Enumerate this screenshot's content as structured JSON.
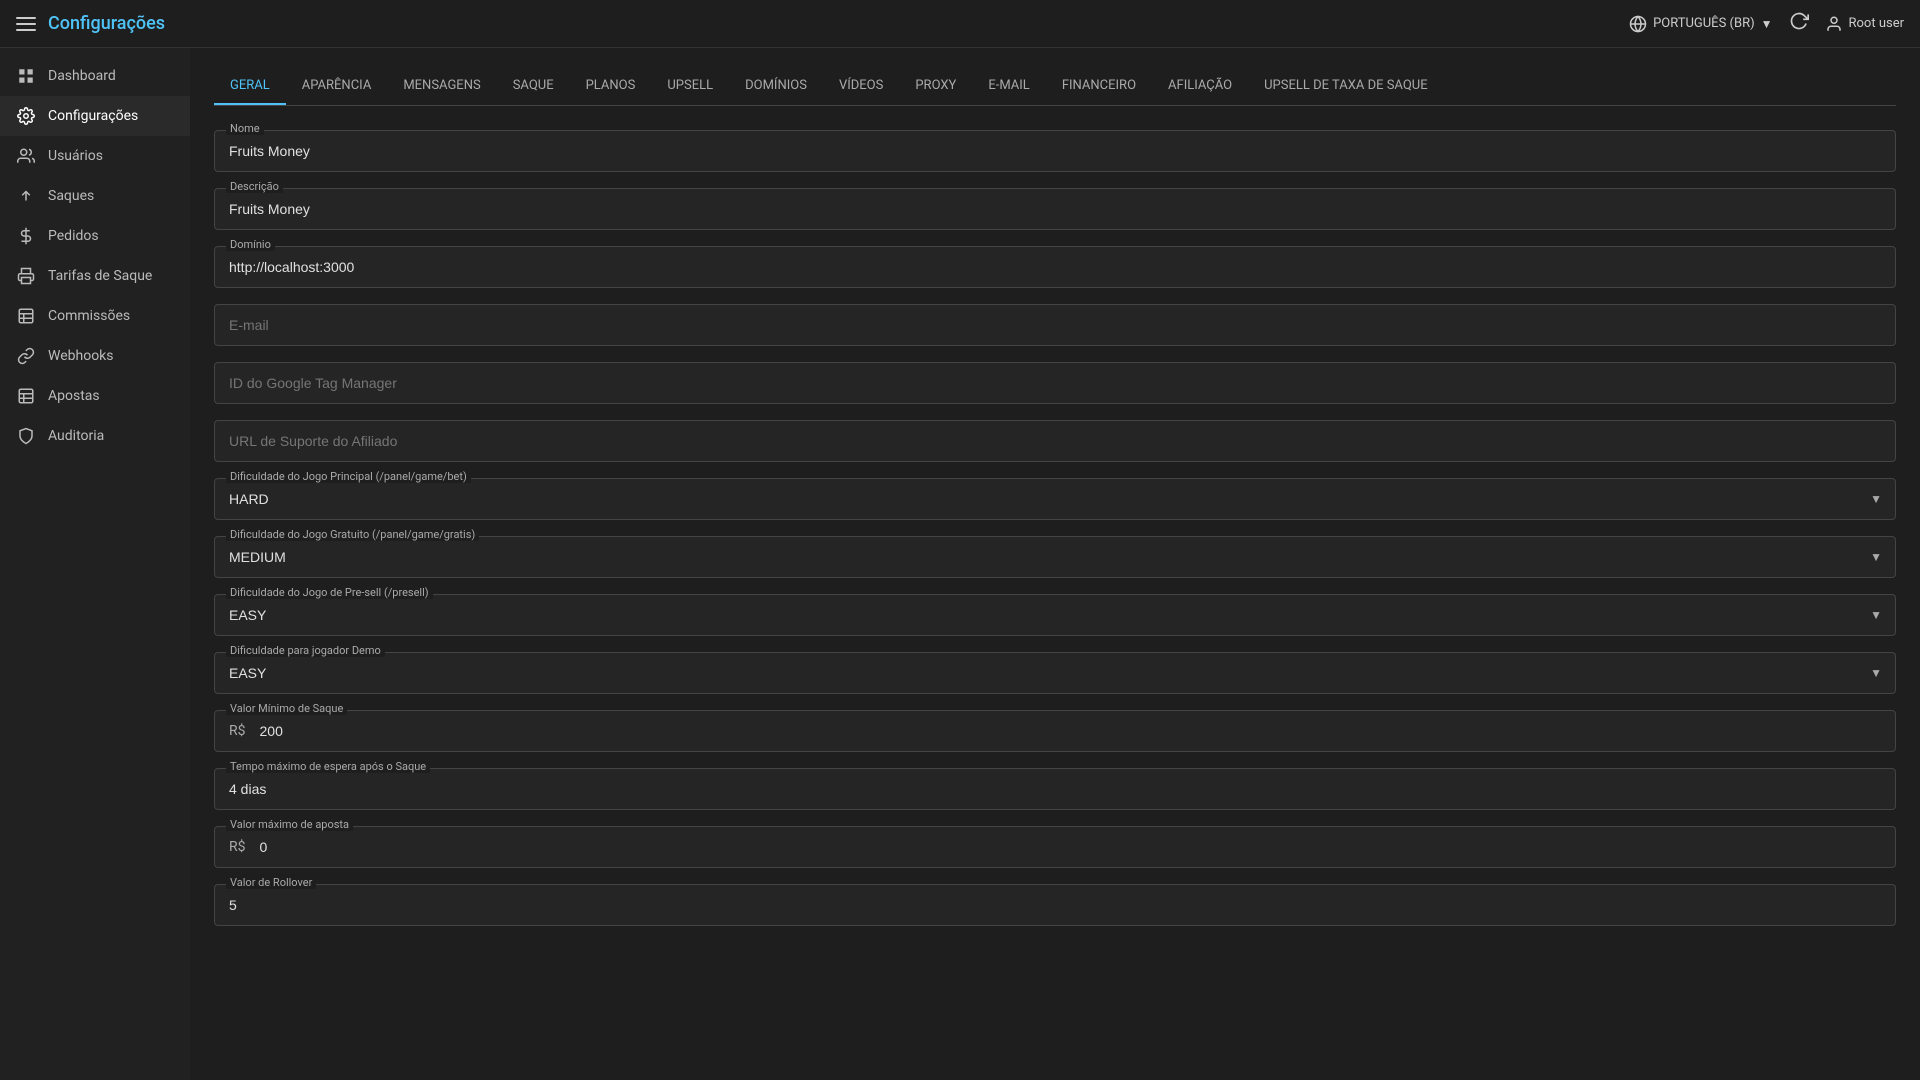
{
  "topbar": {
    "title": "Configurações",
    "language": "PORTUGUÊS (BR)",
    "user": "Root user"
  },
  "sidebar": {
    "items": [
      {
        "id": "dashboard",
        "label": "Dashboard",
        "icon": "grid"
      },
      {
        "id": "configuracoes",
        "label": "Configurações",
        "icon": "settings",
        "active": true
      },
      {
        "id": "usuarios",
        "label": "Usuários",
        "icon": "people"
      },
      {
        "id": "saques",
        "label": "Saques",
        "icon": "upload"
      },
      {
        "id": "pedidos",
        "label": "Pedidos",
        "icon": "dollar"
      },
      {
        "id": "tarifas",
        "label": "Tarifas de Saque",
        "icon": "receipt"
      },
      {
        "id": "comissoes",
        "label": "Commissões",
        "icon": "table"
      },
      {
        "id": "webhooks",
        "label": "Webhooks",
        "icon": "link"
      },
      {
        "id": "apostas",
        "label": "Apostas",
        "icon": "table2"
      },
      {
        "id": "auditoria",
        "label": "Auditoria",
        "icon": "shield"
      }
    ]
  },
  "tabs": [
    {
      "id": "geral",
      "label": "GERAL",
      "active": true
    },
    {
      "id": "aparencia",
      "label": "APARÊNCIA"
    },
    {
      "id": "mensagens",
      "label": "MENSAGENS"
    },
    {
      "id": "saque",
      "label": "SAQUE"
    },
    {
      "id": "planos",
      "label": "PLANOS"
    },
    {
      "id": "upsell",
      "label": "UPSELL"
    },
    {
      "id": "dominios",
      "label": "DOMÍNIOS"
    },
    {
      "id": "videos",
      "label": "VÍDEOS"
    },
    {
      "id": "proxy",
      "label": "PROXY"
    },
    {
      "id": "email",
      "label": "E-MAIL"
    },
    {
      "id": "financeiro",
      "label": "FINANCEIRO"
    },
    {
      "id": "afiliacao",
      "label": "AFILIAÇÃO"
    },
    {
      "id": "upsell_taxa",
      "label": "UPSELL DE TAXA DE SAQUE"
    }
  ],
  "form": {
    "nome_label": "Nome",
    "nome_value": "Fruits Money",
    "descricao_label": "Descrição",
    "descricao_value": "Fruits Money",
    "dominio_label": "Domínio",
    "dominio_value": "http://localhost:3000",
    "email_placeholder": "E-mail",
    "gtm_placeholder": "ID do Google Tag Manager",
    "url_suporte_placeholder": "URL de Suporte do Afiliado",
    "dificuldade_principal_label": "Dificuldade do Jogo Principal (/panel/game/bet)",
    "dificuldade_principal_value": "HARD",
    "dificuldade_gratuito_label": "Dificuldade do Jogo Gratuito (/panel/game/gratis)",
    "dificuldade_gratuito_value": "MEDIUM",
    "dificuldade_presell_label": "Dificuldade do Jogo de Pre-sell (/presell)",
    "dificuldade_presell_value": "EASY",
    "dificuldade_demo_label": "Dificuldade para jogador Demo",
    "dificuldade_demo_value": "EASY",
    "valor_minimo_label": "Valor Mínimo de Saque",
    "valor_minimo_prefix": "R$",
    "valor_minimo_value": "200",
    "tempo_espera_label": "Tempo máximo de espera após o Saque",
    "tempo_espera_value": "4 dias",
    "valor_maximo_label": "Valor máximo de aposta",
    "valor_maximo_prefix": "R$",
    "valor_maximo_value": "0",
    "rollover_label": "Valor de Rollover",
    "rollover_value": "5"
  }
}
